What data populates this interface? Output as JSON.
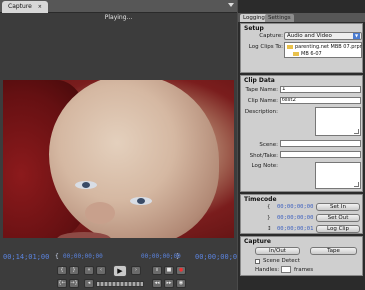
{
  "left_panel": {
    "tab_label": "Capture",
    "tab_close": "×",
    "status_text": "Playing...",
    "timecode_left": "00;14;01;00",
    "timecode_in": "00;00;00;00",
    "timecode_out": "00;00;00;00",
    "timecode_right": "00;00;00;01",
    "play_symbol": "▶"
  },
  "right_panel": {
    "tabs": [
      "Logging",
      "Settings"
    ],
    "setup": {
      "title": "Setup",
      "capture_label": "Capture:",
      "capture_value": "Audio and Video",
      "log_clips_label": "Log Clips To:",
      "folders": [
        "parenting.net MBB 07.prpr",
        "MB 6-07"
      ]
    },
    "clip_data": {
      "title": "Clip Data",
      "tape_name_label": "Tape Name:",
      "tape_name_value": "1",
      "clip_name_label": "Clip Name:",
      "clip_name_value": "test2",
      "description_label": "Description:",
      "scene_label": "Scene:",
      "shot_take_label": "Shot/Take:",
      "log_note_label": "Log Note:"
    },
    "timecode": {
      "title": "Timecode",
      "in_value": "00;00;00;00",
      "out_value": "00;00;00;00",
      "duration_value": "00;00;00;01",
      "set_in_label": "Set In",
      "set_out_label": "Set Out",
      "log_clip_label": "Log Clip"
    },
    "capture": {
      "title": "Capture",
      "in_out_label": "In/Out",
      "tape_label": "Tape",
      "scene_detect_label": "Scene Detect",
      "handles_label": "Handles:",
      "frames_label": "frames"
    }
  },
  "colors": {
    "timecode_blue": "#5b84e0",
    "panel_bg": "#cfcfcf",
    "dark_bg": "#3c3c3c",
    "accent_blue": "#4a7bd0"
  }
}
